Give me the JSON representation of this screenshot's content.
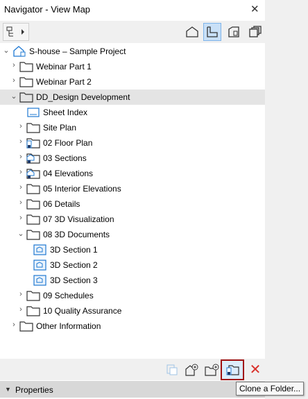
{
  "window": {
    "title": "Navigator - View Map"
  },
  "toolbar": {
    "buttons": [
      {
        "name": "project-map",
        "icon": "house-icon"
      },
      {
        "name": "view-map",
        "icon": "floor-plan-icon",
        "active": true
      },
      {
        "name": "layout-book",
        "icon": "layout-icon"
      },
      {
        "name": "publisher-sets",
        "icon": "stack-icon"
      }
    ]
  },
  "tree": {
    "root_label": "S-house – Sample Project",
    "items": [
      {
        "label": "Webinar Part 1"
      },
      {
        "label": "Webinar Part 2"
      },
      {
        "label": "DD_Design Development"
      },
      {
        "label": "Sheet Index"
      },
      {
        "label": "Site Plan"
      },
      {
        "label": "02 Floor Plan"
      },
      {
        "label": "03 Sections"
      },
      {
        "label": "04 Elevations"
      },
      {
        "label": "05 Interior Elevations"
      },
      {
        "label": "06 Details"
      },
      {
        "label": "07 3D Visualization"
      },
      {
        "label": "08 3D Documents"
      },
      {
        "label": "3D Section 1"
      },
      {
        "label": "3D Section 2"
      },
      {
        "label": "3D Section 3"
      },
      {
        "label": "09 Schedules"
      },
      {
        "label": "10 Quality Assurance"
      },
      {
        "label": "Other Information"
      }
    ]
  },
  "bottom_toolbar": {
    "buttons": [
      "clone-view-icon",
      "new-view-icon",
      "new-folder-icon",
      "clone-folder-icon",
      "delete-icon"
    ]
  },
  "properties": {
    "label": "Properties"
  },
  "tooltip": {
    "text": "Clone a Folder..."
  },
  "colors": {
    "accent": "#1e78d2",
    "selected_row": "#e4e4e4",
    "highlight_border": "#a01010",
    "delete": "#d9302a"
  }
}
